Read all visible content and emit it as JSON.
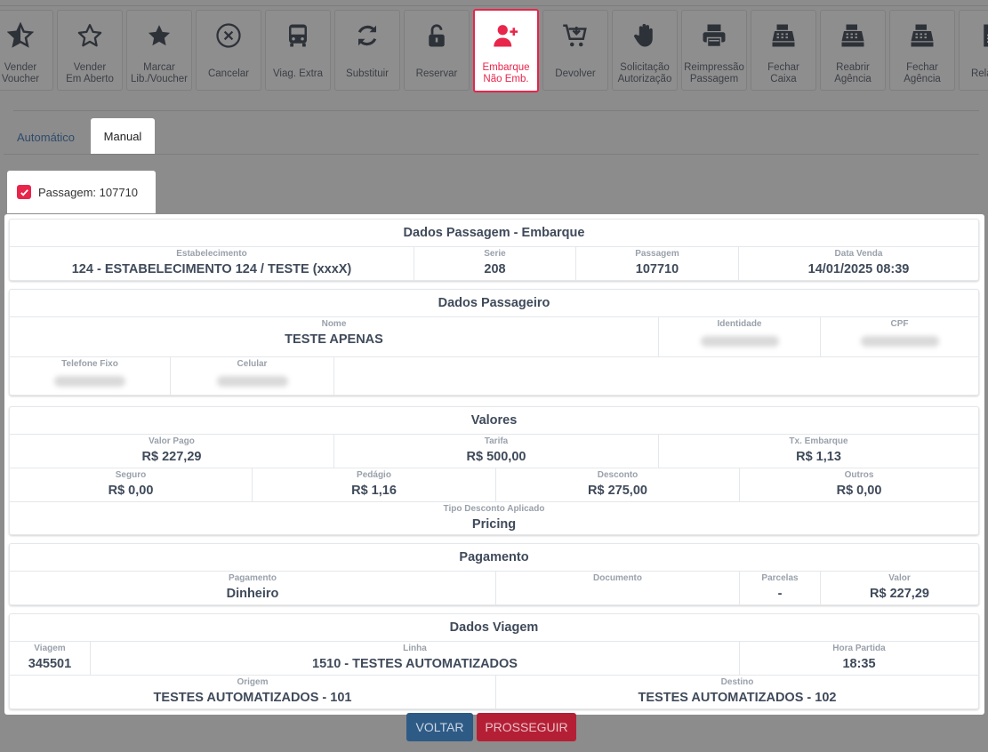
{
  "toolbar": {
    "buttons": [
      {
        "label": "Vender\nVoucher",
        "icon": "star-half-icon"
      },
      {
        "label": "Vender\nEm Aberto",
        "icon": "star-outline-icon"
      },
      {
        "label": "Marcar\nLib./Voucher",
        "icon": "star-filled-icon"
      },
      {
        "label": "Cancelar",
        "icon": "cancel-circle-icon"
      },
      {
        "label": "Viag. Extra",
        "icon": "bus-icon"
      },
      {
        "label": "Substituir",
        "icon": "refresh-icon"
      },
      {
        "label": "Reservar",
        "icon": "unlock-icon"
      },
      {
        "label": "Embarque\nNão Emb.",
        "icon": "user-plus-icon"
      },
      {
        "label": "Devolver",
        "icon": "cart-return-icon"
      },
      {
        "label": "Solicitação\nAutorização",
        "icon": "hand-icon"
      },
      {
        "label": "Reimpressão\nPassagem",
        "icon": "printer-icon"
      },
      {
        "label": "Fechar\nCaixa",
        "icon": "cash-register-icon"
      },
      {
        "label": "Reabrir\nAgência",
        "icon": "cash-register-icon"
      },
      {
        "label": "Fechar\nAgência",
        "icon": "cash-register-icon"
      },
      {
        "label": "Relatório",
        "icon": "document-icon"
      }
    ],
    "active_index": 7,
    "accent_color": "#e8254b"
  },
  "tabs": {
    "automatico": "Automático",
    "manual": "Manual",
    "active": "Manual"
  },
  "passagem_chip": {
    "label": "Passagem: 107710",
    "checked": true
  },
  "dados_passagem": {
    "title": "Dados Passagem - Embarque",
    "estabelecimento_k": "Estabelecimento",
    "estabelecimento_v": "124 - ESTABELECIMENTO 124 / TESTE (xxxX)",
    "serie_k": "Serie",
    "serie_v": "208",
    "passagem_k": "Passagem",
    "passagem_v": "107710",
    "data_venda_k": "Data Venda",
    "data_venda_v": "14/01/2025 08:39"
  },
  "dados_passageiro": {
    "title": "Dados Passageiro",
    "nome_k": "Nome",
    "nome_v": "TESTE APENAS",
    "identidade_k": "Identidade",
    "cpf_k": "CPF",
    "telefone_k": "Telefone Fixo",
    "celular_k": "Celular"
  },
  "valores": {
    "title": "Valores",
    "valor_pago_k": "Valor Pago",
    "valor_pago_v": "R$ 227,29",
    "tarifa_k": "Tarifa",
    "tarifa_v": "R$ 500,00",
    "tx_embarque_k": "Tx. Embarque",
    "tx_embarque_v": "R$ 1,13",
    "seguro_k": "Seguro",
    "seguro_v": "R$ 0,00",
    "pedagio_k": "Pedágio",
    "pedagio_v": "R$ 1,16",
    "desconto_k": "Desconto",
    "desconto_v": "R$ 275,00",
    "outros_k": "Outros",
    "outros_v": "R$ 0,00",
    "tipo_desconto_k": "Tipo Desconto Aplicado",
    "tipo_desconto_v": "Pricing"
  },
  "pagamento": {
    "title": "Pagamento",
    "pagamento_k": "Pagamento",
    "pagamento_v": "Dinheiro",
    "documento_k": "Documento",
    "documento_v": "",
    "parcelas_k": "Parcelas",
    "parcelas_v": "-",
    "valor_k": "Valor",
    "valor_v": "R$ 227,29"
  },
  "dados_viagem": {
    "title": "Dados Viagem",
    "viagem_k": "Viagem",
    "viagem_v": "345501",
    "linha_k": "Linha",
    "linha_v": "1510 - TESTES AUTOMATIZADOS",
    "hora_partida_k": "Hora Partida",
    "hora_partida_v": "18:35",
    "origem_k": "Origem",
    "origem_v": "TESTES AUTOMATIZADOS - 101",
    "destino_k": "Destino",
    "destino_v": "TESTES AUTOMATIZADOS - 102"
  },
  "actions": {
    "voltar": "VOLTAR",
    "prosseguir": "PROSSEGUIR"
  }
}
